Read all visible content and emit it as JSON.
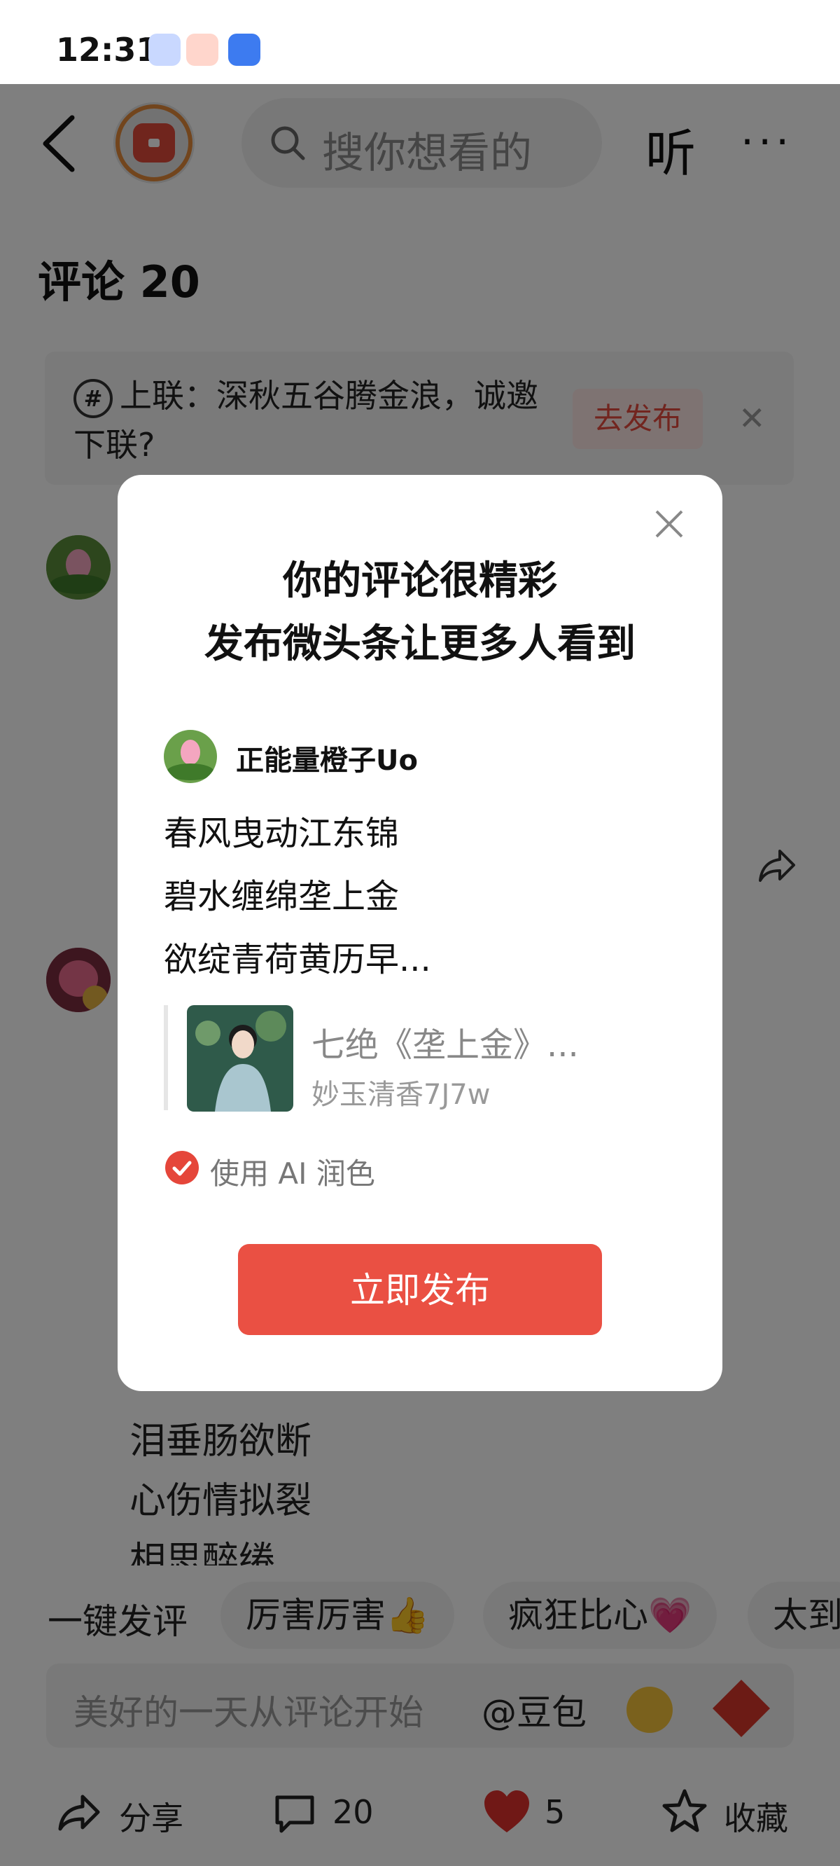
{
  "status_bar": {
    "time": "12:31"
  },
  "nav": {
    "search_placeholder": "搜你想看的",
    "listen_label": "听",
    "more_label": "···"
  },
  "comments": {
    "title": "评论 20",
    "banner": {
      "text": "上联：深秋五谷腾金浪，诚邀下联?",
      "button": "去发布"
    },
    "visible_poem_lines": [
      "泪垂肠欲断",
      "心伤情拟裂",
      "相思醉绻"
    ]
  },
  "quick_replies": {
    "label": "一键发评",
    "chips": [
      "厉害厉害👍",
      "疯狂比心💗",
      "太到"
    ]
  },
  "input": {
    "placeholder": "美好的一天从评论开始",
    "mention": "@豆包"
  },
  "bottom_bar": {
    "share": "分享",
    "comments": "20",
    "likes": "5",
    "favorite": "收藏"
  },
  "modal": {
    "title_line1": "你的评论很精彩",
    "title_line2": "发布微头条让更多人看到",
    "user_name": "正能量橙子Uo",
    "lines": [
      "春风曳动江东锦",
      "碧水缠绵垄上金",
      "欲绽青荷黄历早..."
    ],
    "quote_title": "七绝《垄上金》...",
    "quote_author": "妙玉清香7J7w",
    "ai_option": "使用 AI 润色",
    "ai_checked": true,
    "publish_button": "立即发布"
  },
  "colors": {
    "accent": "#ea5043",
    "heart": "#e0312d"
  }
}
